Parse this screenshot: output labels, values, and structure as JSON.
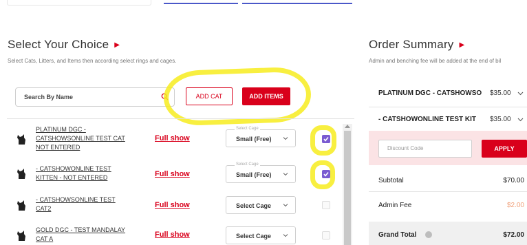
{
  "choice": {
    "title": "Select Your Choice",
    "subtitle": "Select Cats, Litters, and Items then according select rings and cages.",
    "search_placeholder": "Search By Name",
    "add_cat_label": "ADD CAT",
    "add_items_label": "ADD ITEMS",
    "rows": [
      {
        "name_line1": "PLATINUM DGC -",
        "name_line2": "CATSHOWSONLINE TEST CAT",
        "name_line3": "NOT ENTERED",
        "show": "Full show",
        "cage_legend": "Select Cage",
        "cage_value": "Small (Free)",
        "checked": true
      },
      {
        "name_line1": "- CATSHOWONLINE TEST",
        "name_line2": "KITTEN - NOT ENTERED",
        "name_line3": "",
        "show": "Full show",
        "cage_legend": "Select Cage",
        "cage_value": "Small (Free)",
        "checked": true
      },
      {
        "name_line1": "- CATSHOWSONLINE TEST",
        "name_line2": "CAT2",
        "name_line3": "",
        "show": "Full show",
        "cage_legend": "",
        "cage_value": "Select Cage",
        "checked": false
      },
      {
        "name_line1": "GOLD DGC - TEST MANDALAY",
        "name_line2": "CAT A",
        "name_line3": "",
        "show": "Full show",
        "cage_legend": "",
        "cage_value": "Select Cage",
        "checked": false
      }
    ]
  },
  "summary": {
    "title": "Order Summary",
    "subtitle": "Admin and benching fee will be added at the end of bil",
    "items": [
      {
        "name": "PLATINUM DGC - CATSHOWSO",
        "price": "$35.00"
      },
      {
        "name": "- CATSHOWONLINE TEST KIT",
        "price": "$35.00"
      }
    ],
    "discount_placeholder": "Discount Code",
    "apply_label": "APPLY",
    "subtotal_label": "Subtotal",
    "subtotal_value": "$70.00",
    "admin_fee_label": "Admin Fee",
    "admin_fee_value": "$2.00",
    "grand_total_label": "Grand Total",
    "grand_total_value": "$72.00"
  },
  "colors": {
    "accent_red": "#d9001b",
    "checkbox_purple": "#7a5bd1",
    "highlight_yellow": "#f7ec1e",
    "discount_band": "#fbe3e5"
  }
}
